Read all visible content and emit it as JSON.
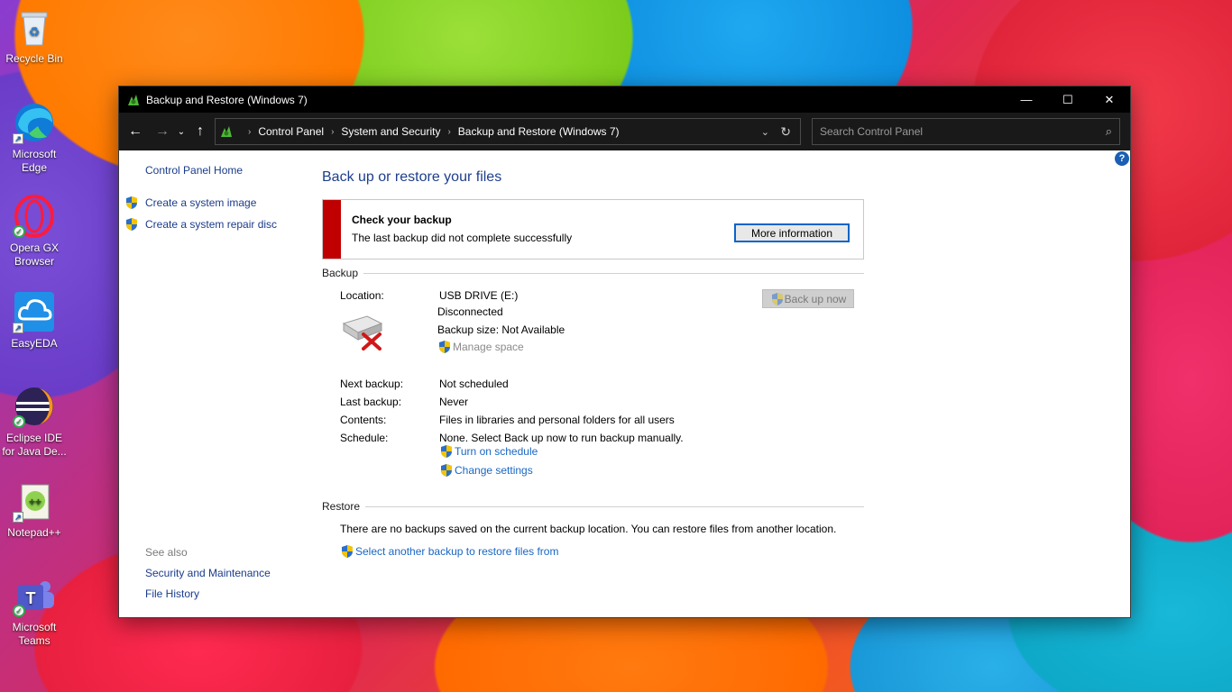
{
  "desktop": {
    "icons": [
      {
        "label": "Recycle Bin",
        "icon": "recycle-bin-icon"
      },
      {
        "label": "Microsoft Edge",
        "icon": "edge-icon"
      },
      {
        "label": "Opera GX Browser",
        "icon": "opera-gx-icon"
      },
      {
        "label": "EasyEDA",
        "icon": "easyeda-icon"
      },
      {
        "label": "Eclipse IDE for Java De...",
        "icon": "eclipse-icon"
      },
      {
        "label": "Notepad++",
        "icon": "notepad-plus-plus-icon"
      },
      {
        "label": "Microsoft Teams",
        "icon": "teams-icon"
      }
    ]
  },
  "window": {
    "title": "Backup and Restore (Windows 7)",
    "controls": {
      "minimize": "—",
      "maximize": "☐",
      "close": "✕"
    }
  },
  "address": {
    "breadcrumbs": [
      "Control Panel",
      "System and Security",
      "Backup and Restore (Windows 7)"
    ],
    "separator": "›",
    "search_placeholder": "Search Control Panel"
  },
  "left_pane": {
    "home": "Control Panel Home",
    "tasks": [
      "Create a system image",
      "Create a system repair disc"
    ],
    "see_also_title": "See also",
    "see_also": [
      "Security and Maintenance",
      "File History"
    ]
  },
  "main": {
    "heading": "Back up or restore your files",
    "alert": {
      "title": "Check your backup",
      "message": "The last backup did not complete successfully",
      "button": "More information",
      "accent": "#c00000"
    },
    "backup": {
      "section_title": "Backup",
      "location_label": "Location:",
      "location_value": "USB DRIVE (E:)",
      "status": "Disconnected",
      "size": "Backup size: Not Available",
      "manage_space": "Manage space",
      "backup_now": "Back up now",
      "next_label": "Next backup:",
      "next_value": "Not scheduled",
      "last_label": "Last backup:",
      "last_value": "Never",
      "contents_label": "Contents:",
      "contents_value": "Files in libraries and personal folders for all users",
      "schedule_label": "Schedule:",
      "schedule_value": "None. Select Back up now to run backup manually.",
      "turn_on_schedule": "Turn on schedule",
      "change_settings": "Change settings"
    },
    "restore": {
      "section_title": "Restore",
      "message": "There are no backups saved on the current backup location. You can restore files from another location.",
      "select_link": "Select another backup to restore files from"
    }
  }
}
